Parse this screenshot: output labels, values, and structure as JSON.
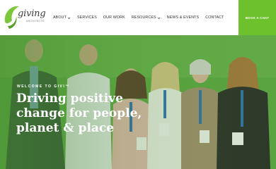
{
  "brand": {
    "name": "giving",
    "tagline": "ARCHITECTS"
  },
  "nav": {
    "items": [
      {
        "label": "ABOUT",
        "has_dropdown": true
      },
      {
        "label": "SERVICES",
        "has_dropdown": false
      },
      {
        "label": "OUR WORK",
        "has_dropdown": false
      },
      {
        "label": "RESOURCES",
        "has_dropdown": true
      },
      {
        "label": "NEWS & EVENTS",
        "has_dropdown": false
      },
      {
        "label": "CONTACT",
        "has_dropdown": false
      }
    ],
    "cta_label": "BOOK A CHAT"
  },
  "hero": {
    "eyebrow": "WELCOME TO GIVI™",
    "headline": "Driving positive change for people, planet & place"
  },
  "colors": {
    "accent": "#6cc12c",
    "hero_overlay": "#5aa640",
    "nav_text": "#2d2d2d"
  }
}
